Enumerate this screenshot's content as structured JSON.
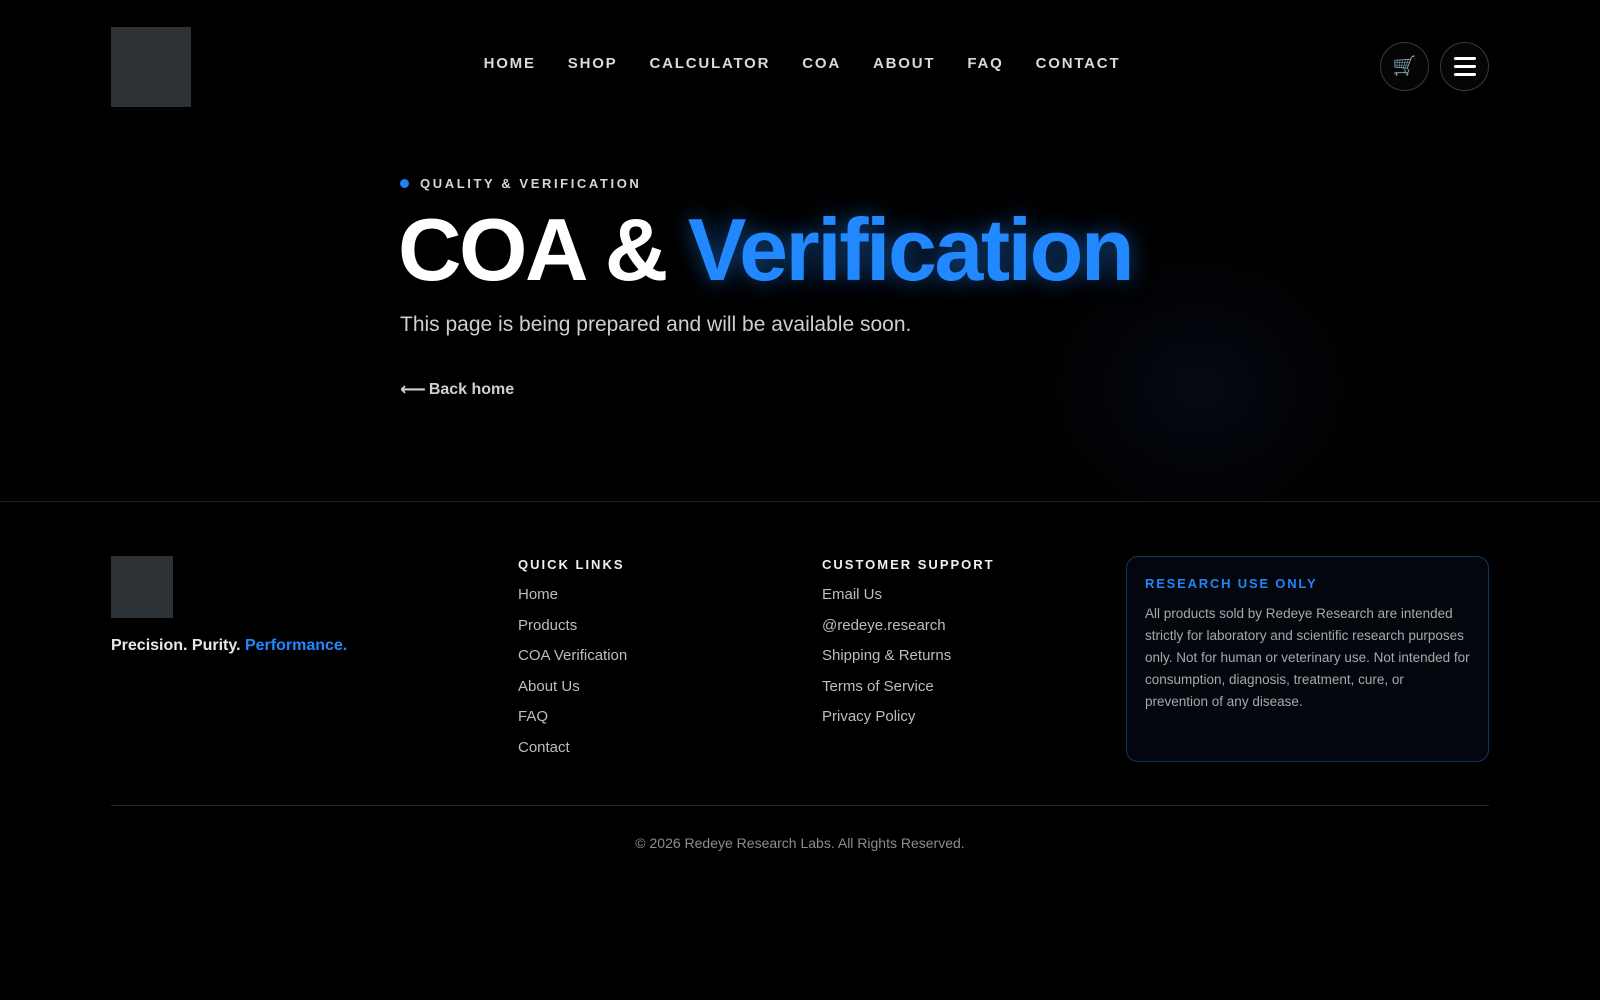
{
  "header": {
    "nav": [
      "HOME",
      "SHOP",
      "CALCULATOR",
      "COA",
      "ABOUT",
      "FAQ",
      "CONTACT"
    ],
    "cart_icon": "🛒",
    "menu_icon": "hamburger-menu-icon"
  },
  "hero": {
    "eyebrow": "QUALITY & VERIFICATION",
    "title_main": "COA & ",
    "title_accent": "Verification",
    "subtitle": "This page is being prepared and will be available soon.",
    "back_arrow": "⟵",
    "back_label": "Back home"
  },
  "footer": {
    "tagline_main": "Precision. Purity. ",
    "tagline_accent": "Performance.",
    "quick_links": {
      "title": "QUICK LINKS",
      "items": [
        "Home",
        "Products",
        "COA Verification",
        "About Us",
        "FAQ",
        "Contact"
      ]
    },
    "customer_support": {
      "title": "CUSTOMER SUPPORT",
      "items": [
        "Email Us",
        "@redeye.research",
        "Shipping & Returns",
        "Terms of Service",
        "Privacy Policy"
      ]
    },
    "notice": {
      "title": "RESEARCH USE ONLY",
      "body": "All products sold by Redeye Research are intended strictly for laboratory and scientific research purposes only. Not for human or veterinary use. Not intended for consumption, diagnosis, treatment, cure, or prevention of any disease."
    },
    "copyright": "© 2026 Redeye Research Labs. All Rights Reserved."
  },
  "colors": {
    "background": "#000000",
    "accent": "#2188ff",
    "logo_placeholder": "#2c3236"
  }
}
